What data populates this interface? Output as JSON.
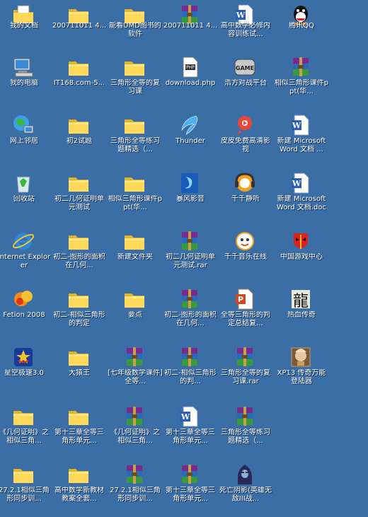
{
  "desktop": {
    "background": "#3a6ea5",
    "icons": [
      {
        "label": "我的文档",
        "type": "mydocs",
        "col": 0,
        "row": 0
      },
      {
        "label": "200711011 4...",
        "type": "folder",
        "col": 1,
        "row": 0
      },
      {
        "label": "能看UMD图书的软件",
        "type": "folder",
        "col": 2,
        "row": 0
      },
      {
        "label": "200711011 4...",
        "type": "rar",
        "col": 3,
        "row": 0
      },
      {
        "label": "高中数学必修内容训练试...",
        "type": "word",
        "col": 4,
        "row": 0
      },
      {
        "label": "腾讯QQ",
        "type": "qq",
        "col": 5,
        "row": 0
      },
      {
        "label": "我的电脑",
        "type": "mycomputer",
        "col": 0,
        "row": 1
      },
      {
        "label": "IT168.com-5...",
        "type": "folder",
        "col": 1,
        "row": 1
      },
      {
        "label": "三角形全等的复习课",
        "type": "folder",
        "col": 2,
        "row": 1
      },
      {
        "label": "download.php",
        "type": "file",
        "col": 3,
        "row": 1
      },
      {
        "label": "浩方对战平台",
        "type": "game",
        "col": 4,
        "row": 1
      },
      {
        "label": "相似三角形课件ppt(华...",
        "type": "rar",
        "col": 5,
        "row": 1
      },
      {
        "label": "网上邻居",
        "type": "network",
        "col": 0,
        "row": 2
      },
      {
        "label": "初2试题",
        "type": "folder",
        "col": 1,
        "row": 2
      },
      {
        "label": "三角形全等练习题精选（...",
        "type": "folder",
        "col": 2,
        "row": 2
      },
      {
        "label": "Thunder",
        "type": "thunder",
        "col": 3,
        "row": 2
      },
      {
        "label": "皮皮免费高清影视",
        "type": "pipi",
        "col": 4,
        "row": 2
      },
      {
        "label": "新建 Microsoft Word 文档 ...",
        "type": "word",
        "col": 5,
        "row": 2
      },
      {
        "label": "回收站",
        "type": "recycle",
        "col": 0,
        "row": 3
      },
      {
        "label": "初二几何证明单元测试",
        "type": "folder",
        "col": 1,
        "row": 3
      },
      {
        "label": "相似三角形课件ppt(华...",
        "type": "folder",
        "col": 2,
        "row": 3
      },
      {
        "label": "暴风影音",
        "type": "storm",
        "col": 3,
        "row": 3
      },
      {
        "label": "千千静听",
        "type": "ttplayer",
        "col": 4,
        "row": 3
      },
      {
        "label": "新建 Microsoft Word 文档.doc",
        "type": "word",
        "col": 5,
        "row": 3
      },
      {
        "label": "Internet Explorer",
        "type": "ie",
        "col": 0,
        "row": 4
      },
      {
        "label": "初二-图形的面积在几何...",
        "type": "folder",
        "col": 1,
        "row": 4
      },
      {
        "label": "新建文件夹",
        "type": "folder",
        "col": 2,
        "row": 4
      },
      {
        "label": "初二几何证明单元测试.rar",
        "type": "rar",
        "col": 3,
        "row": 4
      },
      {
        "label": "千千音乐在线",
        "type": "ttmusic",
        "col": 4,
        "row": 4
      },
      {
        "label": "中国游戏中心",
        "type": "mask",
        "col": 5,
        "row": 4
      },
      {
        "label": "Fetion 2008",
        "type": "fetion",
        "col": 0,
        "row": 5
      },
      {
        "label": "初二-相似三角形的判定",
        "type": "folder",
        "col": 1,
        "row": 5
      },
      {
        "label": "要点",
        "type": "folder",
        "col": 2,
        "row": 5
      },
      {
        "label": "初二-图形的面积在几何...",
        "type": "rar",
        "col": 3,
        "row": 5
      },
      {
        "label": "全等三角形的判定总结复...",
        "type": "ppt",
        "col": 4,
        "row": 5
      },
      {
        "label": "热血传奇",
        "type": "dragon",
        "col": 5,
        "row": 5
      },
      {
        "label": "星空极速3.0",
        "type": "star",
        "col": 0,
        "row": 6
      },
      {
        "label": "大猿王",
        "type": "folder",
        "col": 1,
        "row": 6
      },
      {
        "label": "[七年级数学课件]全等...",
        "type": "rar",
        "col": 2,
        "row": 6
      },
      {
        "label": "初二-相似三角形的判...",
        "type": "rar",
        "col": 3,
        "row": 6
      },
      {
        "label": "三角形全等的复习课.rar",
        "type": "rar",
        "col": 4,
        "row": 6
      },
      {
        "label": "XP13 传奇万能登陆器",
        "type": "xp13",
        "col": 5,
        "row": 6
      },
      {
        "label": "《几何证明》之相似三角...",
        "type": "folder",
        "col": 0,
        "row": 7
      },
      {
        "label": "第十三章全等三角形单元...",
        "type": "folder",
        "col": 1,
        "row": 7
      },
      {
        "label": "《几何证明》之相似三角...",
        "type": "rar",
        "col": 2,
        "row": 7
      },
      {
        "label": "第十三章全等三角形单元...",
        "type": "word",
        "col": 3,
        "row": 7
      },
      {
        "label": "三角形全等练习题精选（...",
        "type": "rar",
        "col": 4,
        "row": 7
      },
      {
        "label": "27.2.1相似三角形同步训...",
        "type": "folder",
        "col": 0,
        "row": 8
      },
      {
        "label": "高中数学新教材教案全套...",
        "type": "folder",
        "col": 1,
        "row": 8
      },
      {
        "label": "27.2.1相似三角形同步训...",
        "type": "rar",
        "col": 2,
        "row": 8
      },
      {
        "label": "第十三章全等三角形单元...",
        "type": "rar",
        "col": 3,
        "row": 8
      },
      {
        "label": "死亡阴影(英雄无敌III战...",
        "type": "hero",
        "col": 4,
        "row": 8
      }
    ]
  }
}
